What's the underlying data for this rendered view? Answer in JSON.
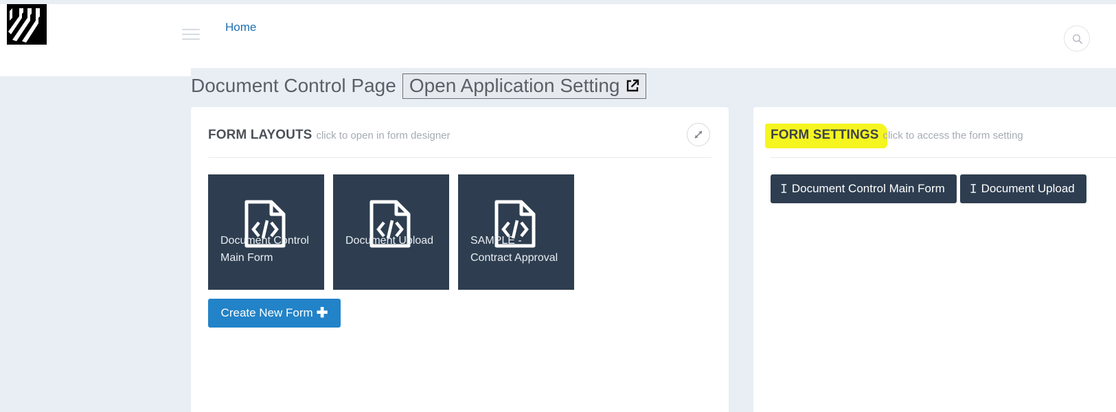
{
  "header": {
    "nav_home": "Home"
  },
  "page": {
    "title": "Document Control Page",
    "open_setting_label": "Open Application Setting"
  },
  "form_layouts": {
    "title": "FORM LAYOUTS",
    "subtitle": "click to open in form designer",
    "tiles": [
      {
        "label": "Document Control Main Form"
      },
      {
        "label": "Document Upload"
      },
      {
        "label": "SAMPLE - Contract Approval"
      }
    ],
    "create_label": "Create New Form"
  },
  "form_settings": {
    "title": "FORM SETTINGS",
    "subtitle": "click to access the form setting",
    "buttons": [
      {
        "label": "Document Control Main Form"
      },
      {
        "label": "Document Upload"
      }
    ]
  },
  "icons": {
    "logo": "company-logo",
    "menu": "hamburger-icon",
    "search": "search-icon",
    "external": "external-link-icon",
    "expand": "expand-icon",
    "tile": "file-code-icon",
    "plus": "plus-icon",
    "cursor": "text-cursor-icon"
  },
  "colors": {
    "tile_bg": "#2e3e50",
    "primary": "#2283c8",
    "highlight": "#f5f520",
    "link": "#1f6fb2"
  }
}
